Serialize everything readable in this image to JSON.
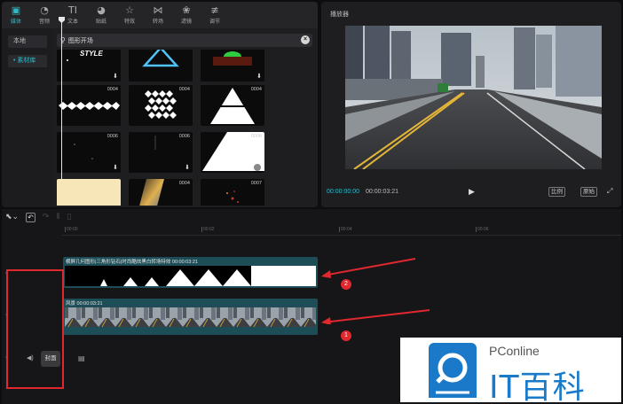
{
  "toolbar": {
    "items": [
      {
        "label": "媒体",
        "icon": "media-icon"
      },
      {
        "label": "音频",
        "icon": "audio-icon"
      },
      {
        "label": "文本",
        "icon": "text-icon"
      },
      {
        "label": "贴纸",
        "icon": "sticker-icon"
      },
      {
        "label": "特效",
        "icon": "effects-icon"
      },
      {
        "label": "转场",
        "icon": "transition-icon"
      },
      {
        "label": "滤镜",
        "icon": "filter-icon"
      },
      {
        "label": "调节",
        "icon": "adjust-icon"
      }
    ]
  },
  "sidebar": {
    "items": [
      {
        "label": "本地"
      },
      {
        "label": "• 素材库"
      }
    ]
  },
  "search": {
    "value": "图形开场"
  },
  "library": {
    "tiles": [
      {
        "duration": ""
      },
      {
        "duration": ""
      },
      {
        "duration": ""
      },
      {
        "duration": "0004"
      },
      {
        "duration": "0004"
      },
      {
        "duration": "0004"
      },
      {
        "duration": "0006"
      },
      {
        "duration": "0006"
      },
      {
        "duration": "0006"
      },
      {
        "duration": ""
      },
      {
        "duration": "0004"
      },
      {
        "duration": "0007"
      }
    ],
    "tile_logo_text": "STYLE"
  },
  "player": {
    "title": "播放器",
    "current_time": "00:00:00:00",
    "total_time": "00:00:03:21",
    "ratio_label": "比例",
    "original_label": "原始"
  },
  "timeline": {
    "ticks": [
      "00:00",
      "00:02",
      "00:04",
      "00:06"
    ],
    "clip_top_label": "横屏几何图形|三角形钻石|时尚酷炫黑白转场特效  00:00:03:21",
    "clip_bottom_label": "风景  00:00:03:21",
    "cover_label": "封面",
    "badges": [
      "1",
      "2"
    ]
  },
  "colors": {
    "accent": "#2fb9c7",
    "clip": "#1d4e57",
    "annotation": "#e0282e",
    "watermark_blue": "#1a7ac9"
  },
  "watermark": {
    "brand": "PConline",
    "name": "IT百科"
  }
}
